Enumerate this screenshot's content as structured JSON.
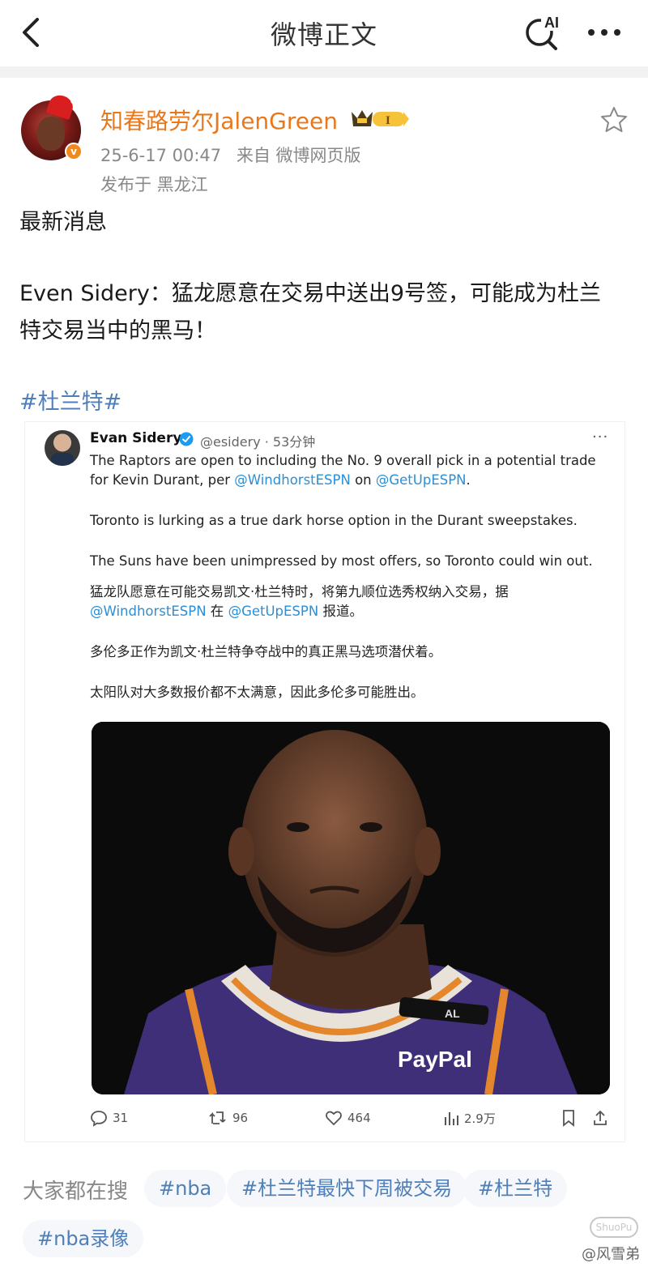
{
  "nav": {
    "title": "微博正文",
    "ai_label": "AI"
  },
  "post": {
    "username": "知春路劳尔JalenGreen",
    "vip_level": "I",
    "timestamp": "25-6-17 00:47",
    "source": "来自 微博网页版",
    "location": "发布于 黑龙江",
    "text_lines": [
      "最新消息",
      "Even Sidery：猛龙愿意在交易中送出9号签，可能成为杜兰",
      "特交易当中的黑马！"
    ],
    "hashtag": "#杜兰特#"
  },
  "tweet": {
    "name": "Evan Sidery",
    "handle": "@esidery · 53分钟",
    "lines": {
      "l1": "The Raptors are open to including the No. 9 overall pick in a potential trade",
      "l2_a": "for Kevin Durant, per ",
      "l2_link1": "@WindhorstESPN",
      "l2_b": " on ",
      "l2_link2": "@GetUpESPN",
      "l2_c": ".",
      "l3": "Toronto is lurking as a true dark horse option in the Durant sweepstakes.",
      "l4": "The Suns have been unimpressed by most offers, so Toronto could win out.",
      "l5": "猛龙队愿意在可能交易凯文·杜兰特时，将第九顺位选秀权纳入交易，据",
      "l6_link1": "@WindhorstESPN",
      "l6_b": " 在 ",
      "l6_link2": "@GetUpESPN",
      "l6_c": " 报道。",
      "l7": "多伦多正作为凯文·杜兰特争夺战中的真正黑马选项潜伏着。",
      "l8": "太阳队对大多数报价都不太满意，因此多伦多可能胜出。"
    },
    "photo": {
      "jersey_text": "PayPal",
      "armband_text": "AL"
    },
    "actions": {
      "replies": "31",
      "retweets": "96",
      "likes": "464",
      "views": "2.9万"
    }
  },
  "search": {
    "label": "大家都在搜",
    "chips": [
      "#nba",
      "#杜兰特最快下周被交易",
      "#杜兰特",
      "#nba录像"
    ]
  },
  "watermark": {
    "text": "@风雪弟",
    "logo_text": "ShuoPu"
  },
  "colors": {
    "username": "#e8781c",
    "link": "#4f7fb8",
    "twitter_link": "#2a8fd6",
    "verified_badge": "#f08a1c"
  }
}
